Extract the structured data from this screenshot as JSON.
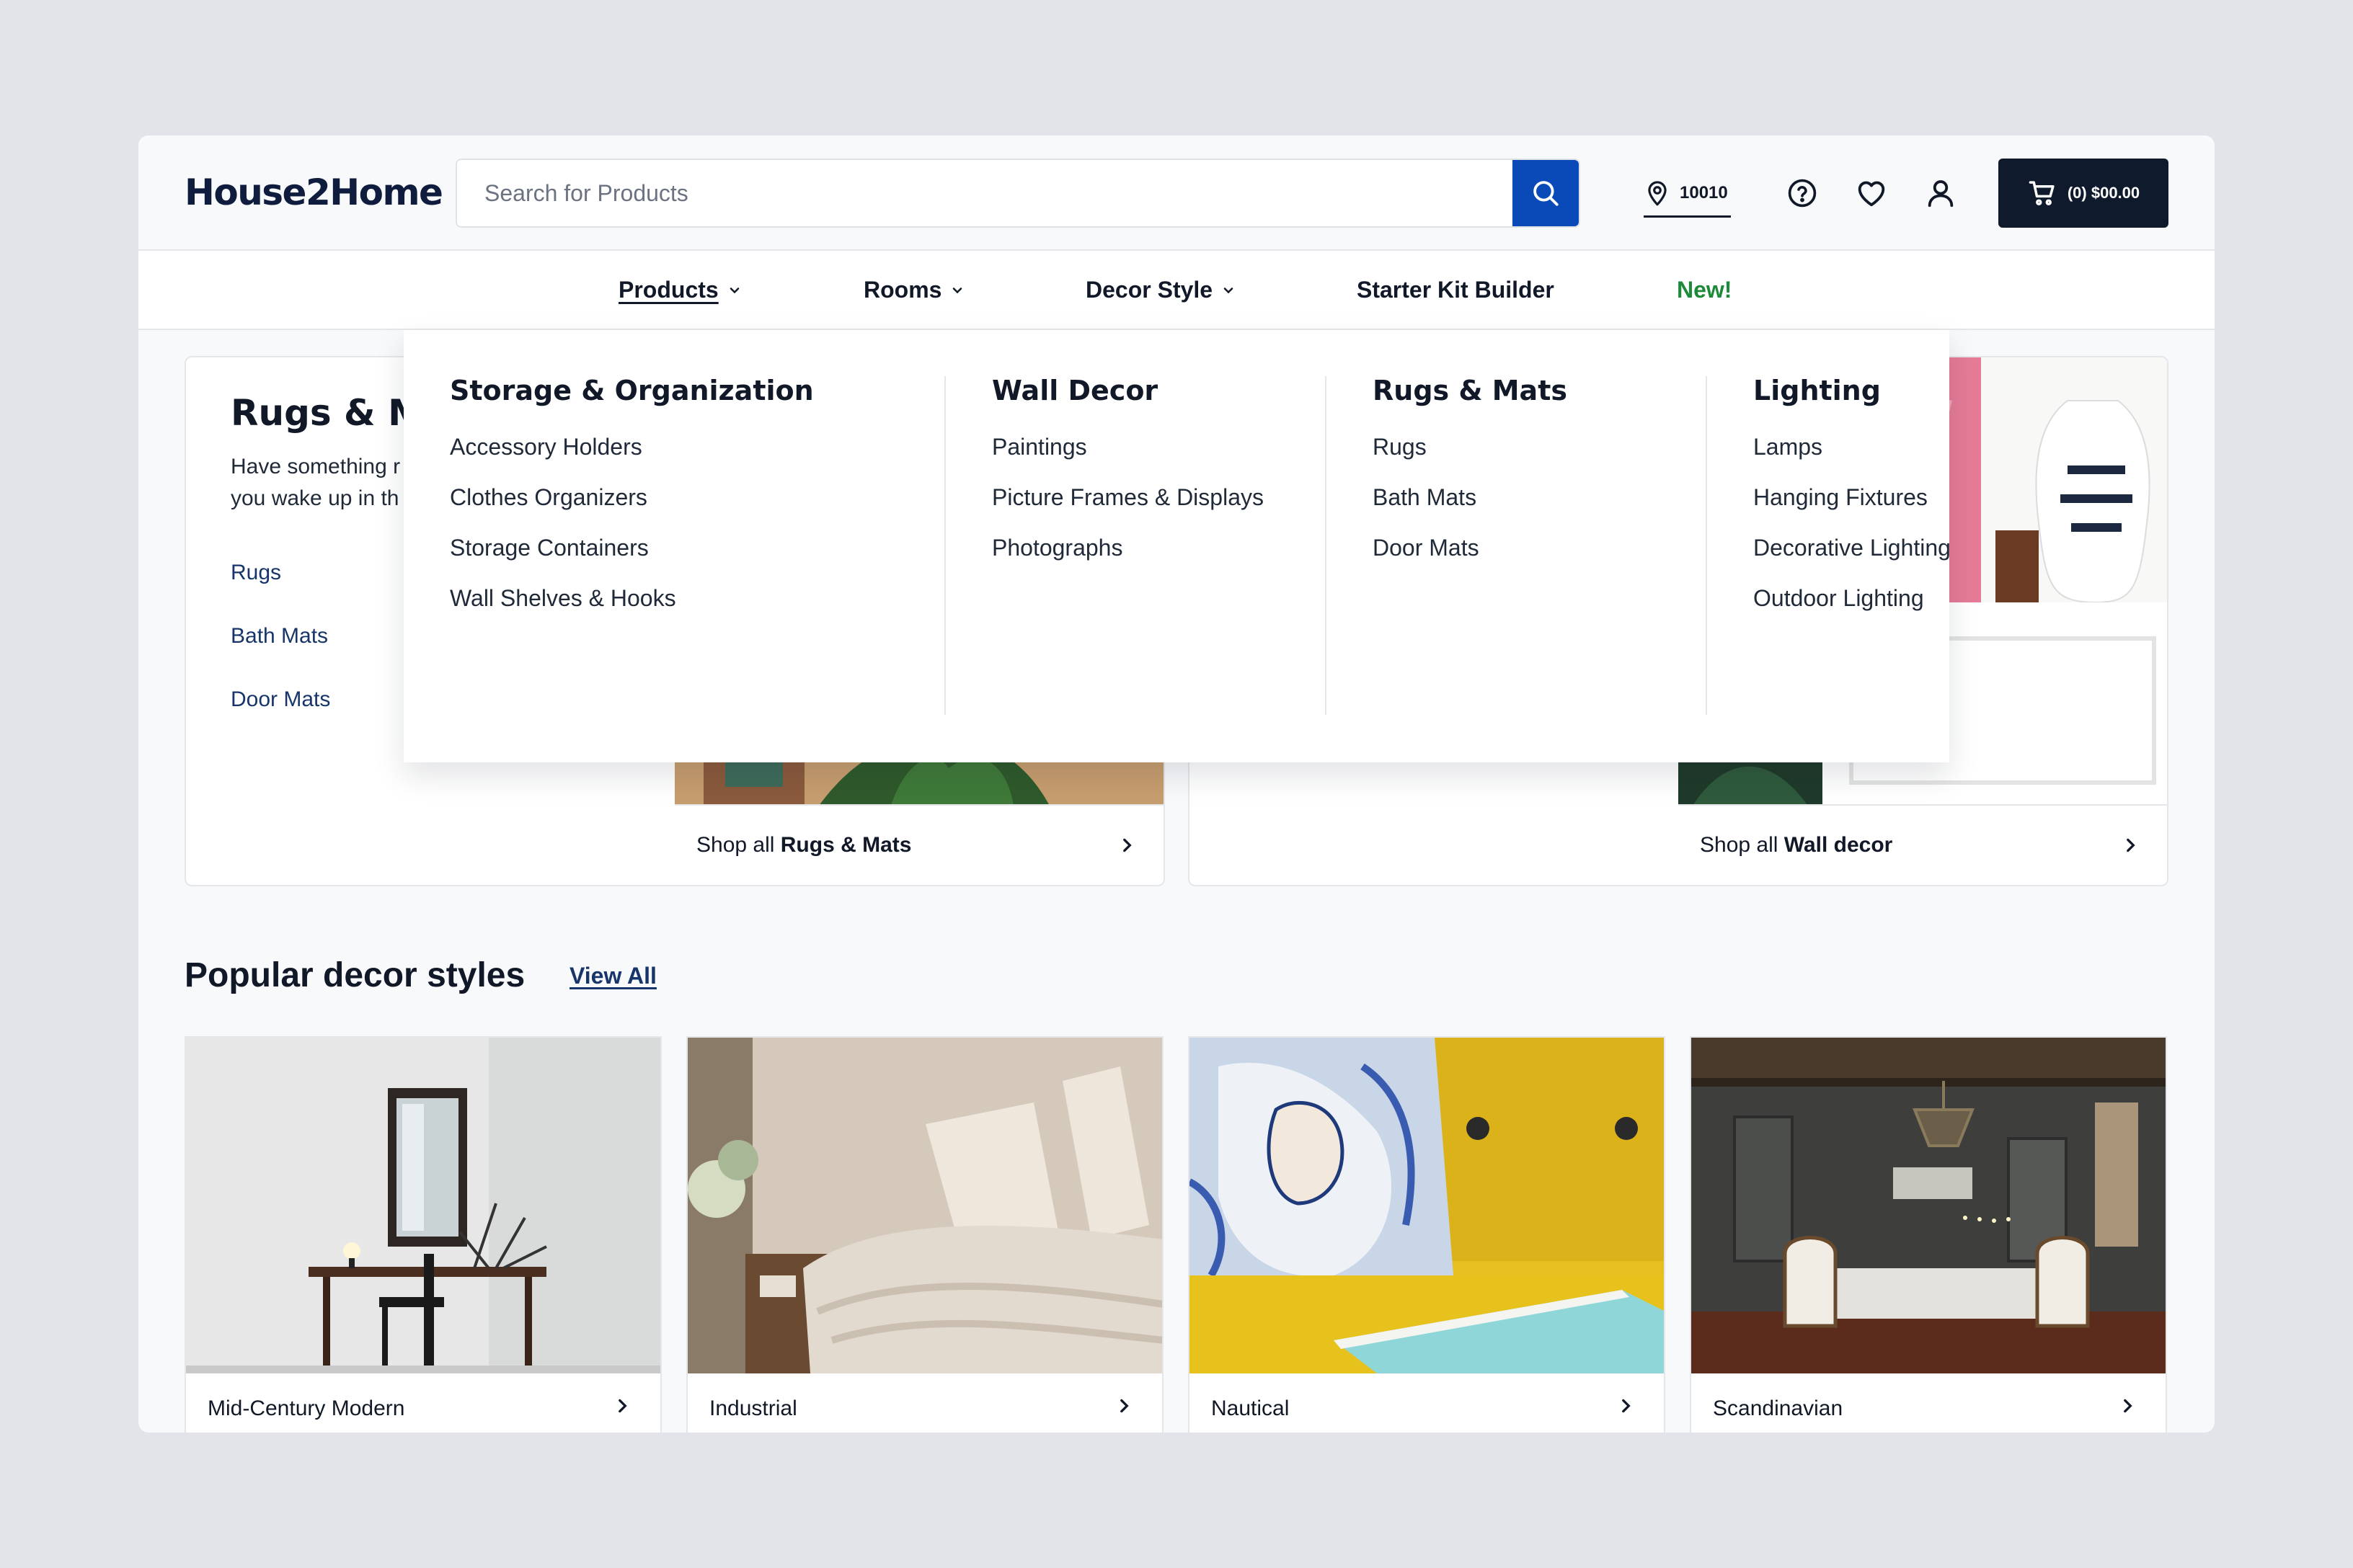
{
  "header": {
    "logo": "House2Home",
    "search_placeholder": "Search for Products",
    "zip": "10010",
    "cart_label": "(0) $00.00"
  },
  "nav": {
    "items": [
      {
        "label": "Products"
      },
      {
        "label": "Rooms"
      },
      {
        "label": "Decor Style"
      },
      {
        "label": "Starter Kit Builder"
      },
      {
        "label": "New!"
      }
    ]
  },
  "mega_menu": {
    "columns": [
      {
        "heading": "Storage & Organization",
        "items": [
          "Accessory Holders",
          "Clothes Organizers",
          "Storage Containers",
          "Wall Shelves & Hooks"
        ]
      },
      {
        "heading": "Wall Decor",
        "items": [
          "Paintings",
          "Picture Frames & Displays",
          "Photographs"
        ]
      },
      {
        "heading": "Rugs & Mats",
        "items": [
          "Rugs",
          "Bath Mats",
          "Door Mats"
        ]
      },
      {
        "heading": "Lighting",
        "items": [
          "Lamps",
          "Hanging Fixtures",
          "Decorative Lighting",
          "Outdoor Lighting"
        ]
      }
    ]
  },
  "feature_cards": [
    {
      "title": "Rugs & Ma",
      "desc_line1": "Have something r",
      "desc_line2": "you wake up in th",
      "links": [
        "Rugs",
        "Bath Mats",
        "Door Mats"
      ],
      "shop_prefix": "Shop all ",
      "shop_bold": "Rugs & Mats"
    },
    {
      "shop_prefix": "Shop all ",
      "shop_bold": "Wall decor"
    }
  ],
  "popular": {
    "title": "Popular decor styles",
    "view_all": "View All",
    "styles": [
      {
        "label": "Mid-Century Modern"
      },
      {
        "label": "Industrial"
      },
      {
        "label": "Nautical"
      },
      {
        "label": "Scandinavian"
      }
    ]
  },
  "colors": {
    "brand_navy": "#101c3d",
    "search_button": "#0a4ab8",
    "cart_bg": "#0f1b2d",
    "new_green": "#1d8a3a",
    "link_blue": "#17356b"
  }
}
